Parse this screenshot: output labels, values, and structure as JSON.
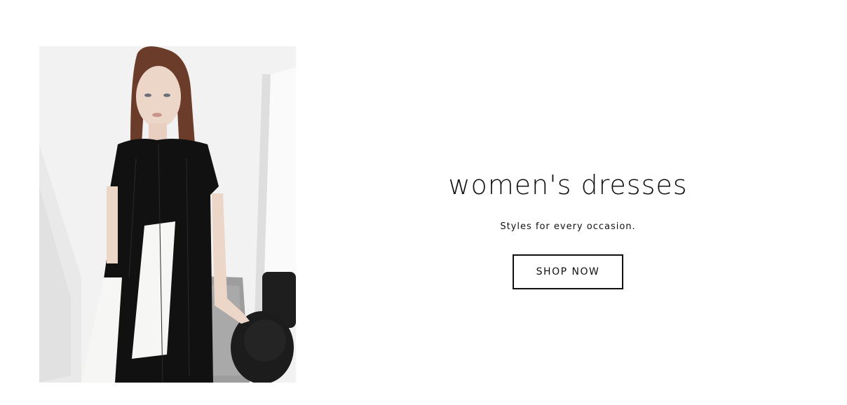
{
  "hero": {
    "image_alt": "Model wearing a black dress with white panels, holding a black backpack",
    "colors": {
      "background": "#f2f2f2",
      "dress": "#111111",
      "panel": "#f6f6f4",
      "bag": "#1c1c1c",
      "skin": "#ecd6c8",
      "hair": "#6b3c2a"
    }
  },
  "promo": {
    "title": "women's dresses",
    "subtitle": "Styles for every occasion.",
    "button_label": "SHOP NOW"
  }
}
